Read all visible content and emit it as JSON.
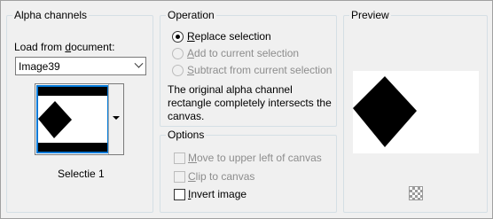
{
  "alpha_channels": {
    "title": "Alpha channels",
    "load_from_document_label_pre": "Load from ",
    "load_from_document_label_ul": "d",
    "load_from_document_label_post": "ocument:",
    "document_value": "Image39",
    "thumbnail_caption": "Selectie 1"
  },
  "operation": {
    "title": "Operation",
    "options": [
      {
        "ul": "R",
        "rest": "eplace selection",
        "checked": true,
        "enabled": true
      },
      {
        "ul": "A",
        "rest": "dd to current selection",
        "checked": false,
        "enabled": false
      },
      {
        "ul": "S",
        "rest": "ubtract from current selection",
        "checked": false,
        "enabled": false
      }
    ],
    "description": "The original alpha channel rectangle completely intersects the canvas."
  },
  "options": {
    "title": "Options",
    "move_pre": "",
    "move_ul": "M",
    "move_post": "ove to upper left of canvas",
    "clip_ul": "C",
    "clip_post": "lip to canvas",
    "invert_ul": "I",
    "invert_post": "nvert image"
  },
  "preview": {
    "title": "Preview"
  },
  "colors": {
    "accent": "#0078d7",
    "disabled_text": "#8d8d8d"
  }
}
